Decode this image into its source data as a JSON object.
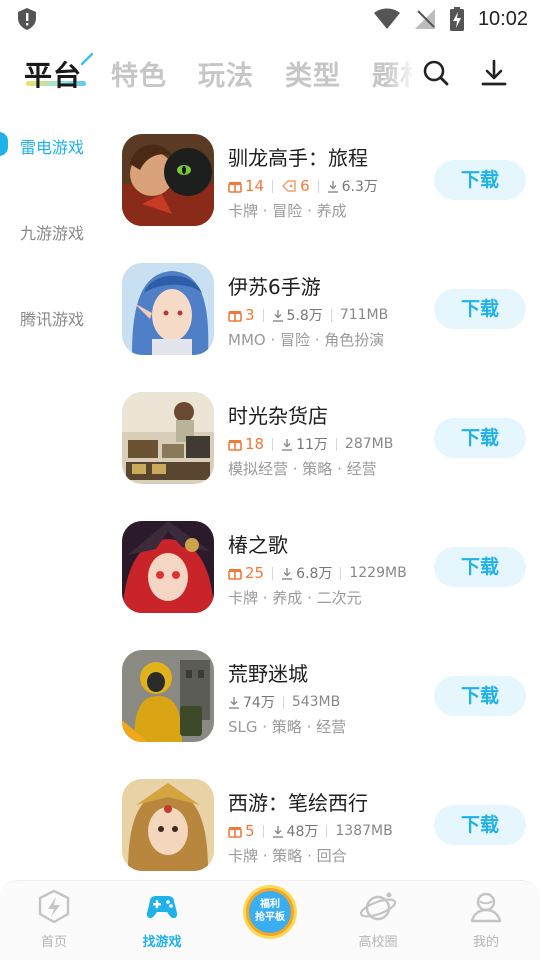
{
  "status_bar": {
    "time": "10:02",
    "icons": [
      "shield-alert-icon",
      "wifi-icon",
      "no-signal-icon",
      "battery-charging-icon"
    ]
  },
  "top_tabs": {
    "items": [
      {
        "label": "平台",
        "active": true
      },
      {
        "label": "特色",
        "active": false
      },
      {
        "label": "玩法",
        "active": false
      },
      {
        "label": "类型",
        "active": false
      },
      {
        "label": "题材",
        "active": false
      }
    ],
    "icons": [
      "search-icon",
      "download-icon"
    ]
  },
  "sidebar": {
    "items": [
      {
        "label": "雷电游戏",
        "active": true
      },
      {
        "label": "九游游戏",
        "active": false
      },
      {
        "label": "腾讯游戏",
        "active": false
      }
    ]
  },
  "games": [
    {
      "name": "驯龙高手：旅程",
      "gifts": "14",
      "coupons": "6",
      "downloads": "6.3万",
      "size": "",
      "tags": "卡牌 · 冒险 · 养成",
      "button": "下载"
    },
    {
      "name": "伊苏6手游",
      "gifts": "3",
      "coupons": "",
      "downloads": "5.8万",
      "size": "711MB",
      "tags": "MMO · 冒险 · 角色扮演",
      "button": "下载"
    },
    {
      "name": "时光杂货店",
      "gifts": "18",
      "coupons": "",
      "downloads": "11万",
      "size": "287MB",
      "tags": "模拟经营 · 策略 · 经营",
      "button": "下载"
    },
    {
      "name": "椿之歌",
      "gifts": "25",
      "coupons": "",
      "downloads": "6.8万",
      "size": "1229MB",
      "tags": "卡牌 · 养成 · 二次元",
      "button": "下载"
    },
    {
      "name": "荒野迷城",
      "gifts": "",
      "coupons": "",
      "downloads": "74万",
      "size": "543MB",
      "tags": "SLG · 策略 · 经营",
      "button": "下载"
    },
    {
      "name": "西游：笔绘西行",
      "gifts": "5",
      "coupons": "",
      "downloads": "48万",
      "size": "1387MB",
      "tags": "卡牌 · 策略 · 回合",
      "button": "下载"
    }
  ],
  "bottom_nav": {
    "items": [
      {
        "label": "首页",
        "icon": "lightning-home-icon",
        "active": false
      },
      {
        "label": "找游戏",
        "icon": "gamepad-icon",
        "active": true
      },
      {
        "label": "高校圈",
        "icon": "planet-icon",
        "active": false
      },
      {
        "label": "我的",
        "icon": "profile-icon",
        "active": false
      }
    ],
    "center_badge": "福利抢平板"
  },
  "colors": {
    "accent": "#1fb2e8",
    "gift": "#f07a3a",
    "button_bg": "#e6f6fd"
  }
}
